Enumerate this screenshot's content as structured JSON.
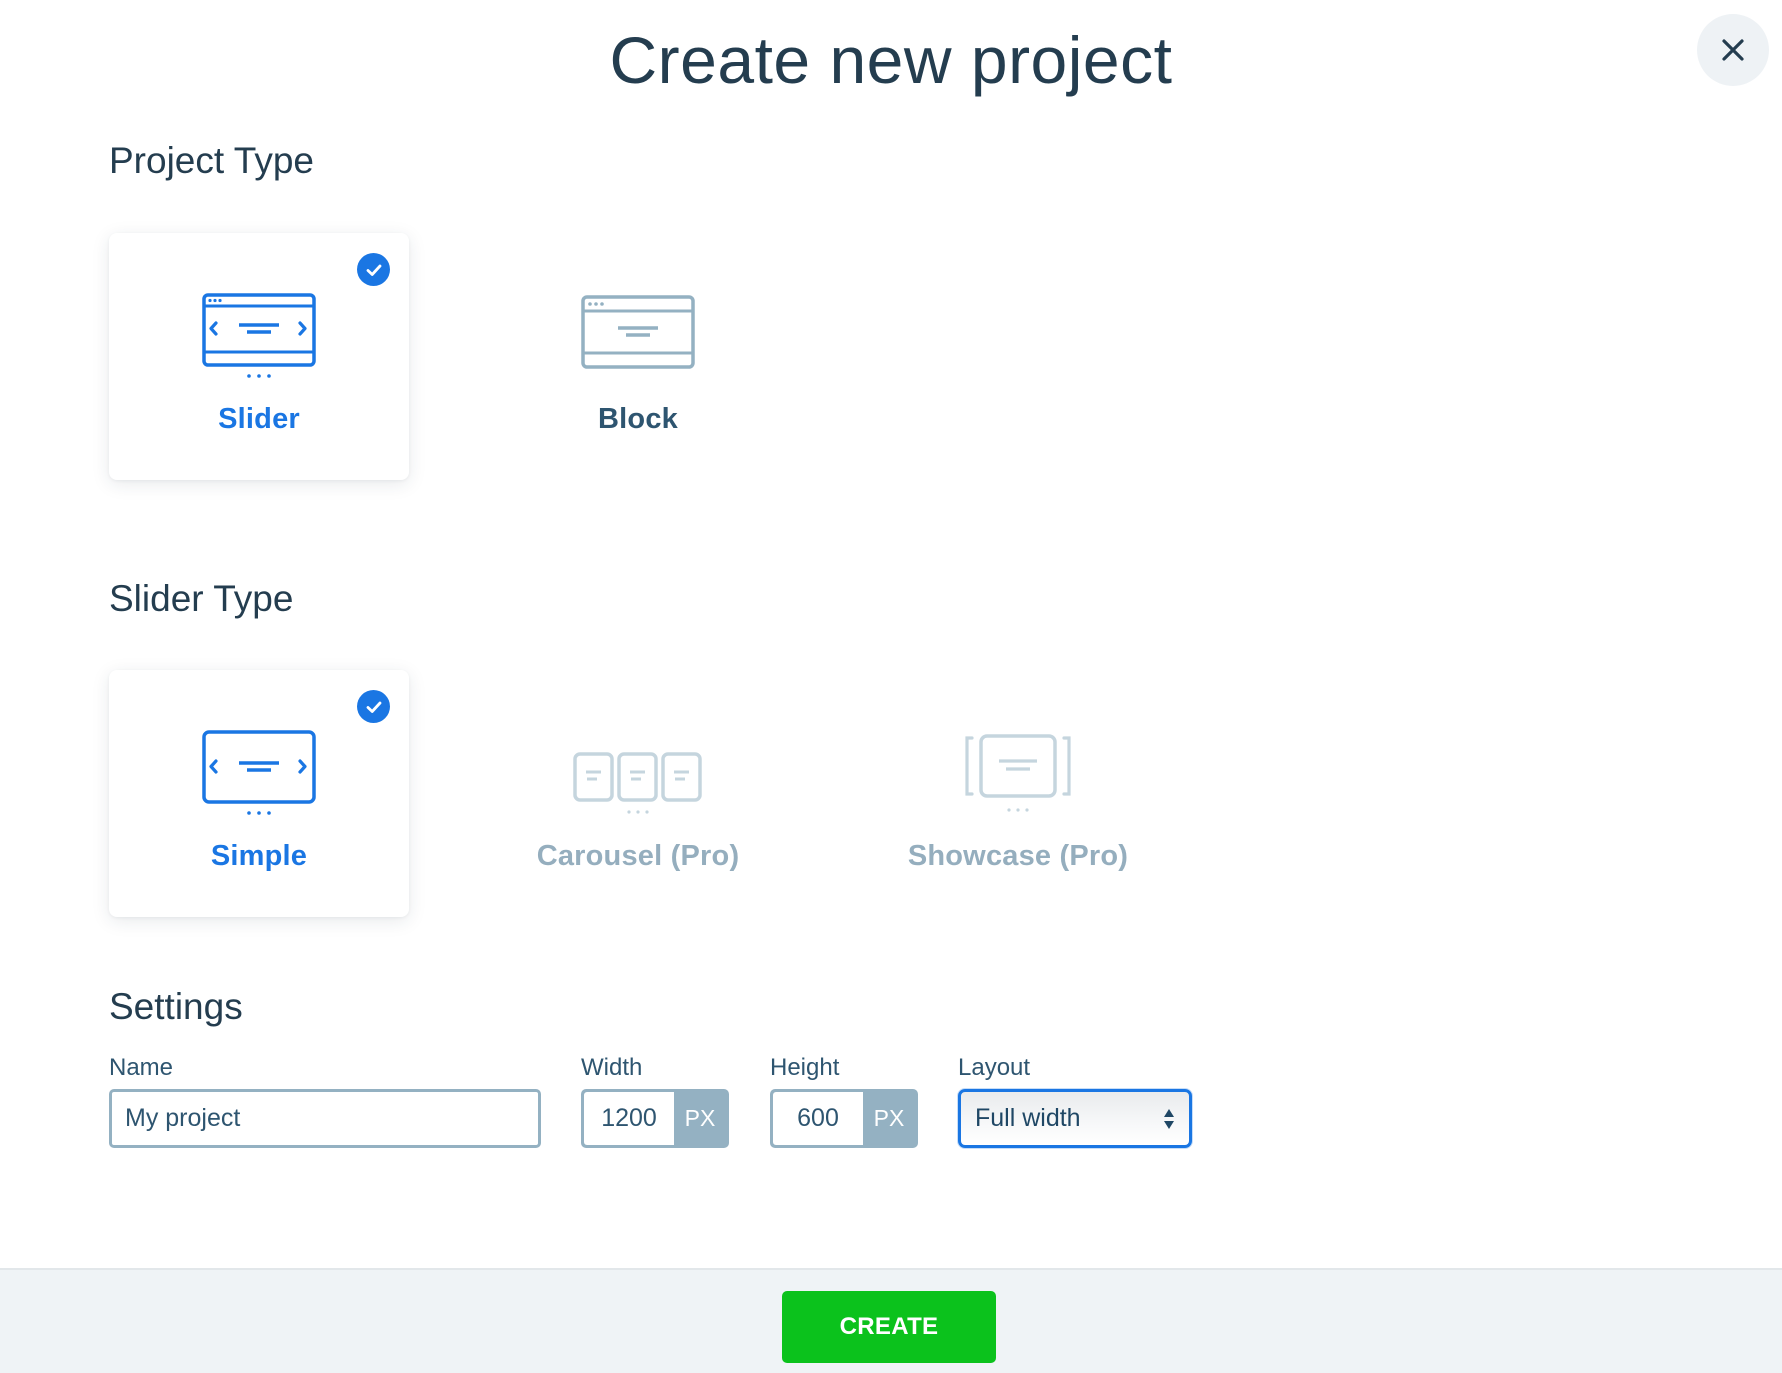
{
  "dialog": {
    "title": "Create new project",
    "close_icon": "close-icon"
  },
  "project_type": {
    "heading": "Project Type",
    "options": [
      {
        "label": "Slider",
        "icon": "slider-window-icon",
        "selected": true
      },
      {
        "label": "Block",
        "icon": "block-window-icon",
        "selected": false
      }
    ]
  },
  "slider_type": {
    "heading": "Slider Type",
    "options": [
      {
        "label": "Simple",
        "icon": "simple-slider-icon",
        "selected": true,
        "disabled": false
      },
      {
        "label": "Carousel (Pro)",
        "icon": "carousel-icon",
        "selected": false,
        "disabled": true
      },
      {
        "label": "Showcase (Pro)",
        "icon": "showcase-icon",
        "selected": false,
        "disabled": true
      }
    ]
  },
  "settings": {
    "heading": "Settings",
    "name": {
      "label": "Name",
      "value": "My project"
    },
    "width": {
      "label": "Width",
      "value": "1200",
      "unit": "PX"
    },
    "height": {
      "label": "Height",
      "value": "600",
      "unit": "PX"
    },
    "layout": {
      "label": "Layout",
      "value": "Full width"
    }
  },
  "footer": {
    "create_label": "CREATE"
  },
  "colors": {
    "accent": "#1a76e3",
    "create": "#0bc21c",
    "muted": "#94b1c2",
    "disabled": "#c5d5de",
    "text": "#243d4f"
  }
}
